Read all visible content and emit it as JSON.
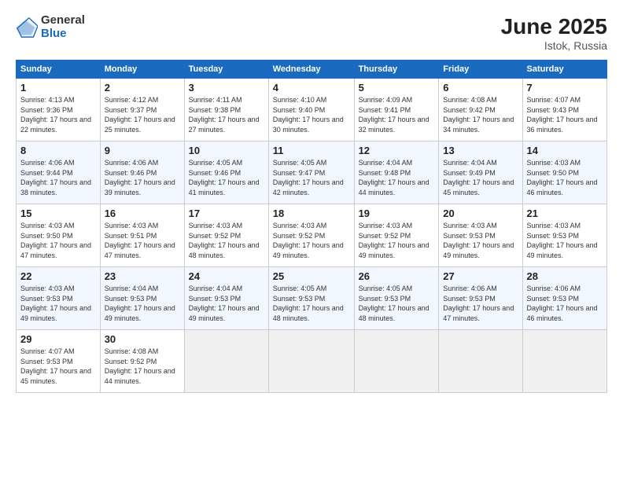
{
  "logo": {
    "general": "General",
    "blue": "Blue"
  },
  "title": "June 2025",
  "location": "Istok, Russia",
  "days_of_week": [
    "Sunday",
    "Monday",
    "Tuesday",
    "Wednesday",
    "Thursday",
    "Friday",
    "Saturday"
  ],
  "weeks": [
    [
      {
        "day": "1",
        "sunrise": "4:13 AM",
        "sunset": "9:36 PM",
        "daylight": "17 hours and 22 minutes."
      },
      {
        "day": "2",
        "sunrise": "4:12 AM",
        "sunset": "9:37 PM",
        "daylight": "17 hours and 25 minutes."
      },
      {
        "day": "3",
        "sunrise": "4:11 AM",
        "sunset": "9:38 PM",
        "daylight": "17 hours and 27 minutes."
      },
      {
        "day": "4",
        "sunrise": "4:10 AM",
        "sunset": "9:40 PM",
        "daylight": "17 hours and 30 minutes."
      },
      {
        "day": "5",
        "sunrise": "4:09 AM",
        "sunset": "9:41 PM",
        "daylight": "17 hours and 32 minutes."
      },
      {
        "day": "6",
        "sunrise": "4:08 AM",
        "sunset": "9:42 PM",
        "daylight": "17 hours and 34 minutes."
      },
      {
        "day": "7",
        "sunrise": "4:07 AM",
        "sunset": "9:43 PM",
        "daylight": "17 hours and 36 minutes."
      }
    ],
    [
      {
        "day": "8",
        "sunrise": "4:06 AM",
        "sunset": "9:44 PM",
        "daylight": "17 hours and 38 minutes."
      },
      {
        "day": "9",
        "sunrise": "4:06 AM",
        "sunset": "9:46 PM",
        "daylight": "17 hours and 39 minutes."
      },
      {
        "day": "10",
        "sunrise": "4:05 AM",
        "sunset": "9:46 PM",
        "daylight": "17 hours and 41 minutes."
      },
      {
        "day": "11",
        "sunrise": "4:05 AM",
        "sunset": "9:47 PM",
        "daylight": "17 hours and 42 minutes."
      },
      {
        "day": "12",
        "sunrise": "4:04 AM",
        "sunset": "9:48 PM",
        "daylight": "17 hours and 44 minutes."
      },
      {
        "day": "13",
        "sunrise": "4:04 AM",
        "sunset": "9:49 PM",
        "daylight": "17 hours and 45 minutes."
      },
      {
        "day": "14",
        "sunrise": "4:03 AM",
        "sunset": "9:50 PM",
        "daylight": "17 hours and 46 minutes."
      }
    ],
    [
      {
        "day": "15",
        "sunrise": "4:03 AM",
        "sunset": "9:50 PM",
        "daylight": "17 hours and 47 minutes."
      },
      {
        "day": "16",
        "sunrise": "4:03 AM",
        "sunset": "9:51 PM",
        "daylight": "17 hours and 47 minutes."
      },
      {
        "day": "17",
        "sunrise": "4:03 AM",
        "sunset": "9:52 PM",
        "daylight": "17 hours and 48 minutes."
      },
      {
        "day": "18",
        "sunrise": "4:03 AM",
        "sunset": "9:52 PM",
        "daylight": "17 hours and 49 minutes."
      },
      {
        "day": "19",
        "sunrise": "4:03 AM",
        "sunset": "9:52 PM",
        "daylight": "17 hours and 49 minutes."
      },
      {
        "day": "20",
        "sunrise": "4:03 AM",
        "sunset": "9:53 PM",
        "daylight": "17 hours and 49 minutes."
      },
      {
        "day": "21",
        "sunrise": "4:03 AM",
        "sunset": "9:53 PM",
        "daylight": "17 hours and 49 minutes."
      }
    ],
    [
      {
        "day": "22",
        "sunrise": "4:03 AM",
        "sunset": "9:53 PM",
        "daylight": "17 hours and 49 minutes."
      },
      {
        "day": "23",
        "sunrise": "4:04 AM",
        "sunset": "9:53 PM",
        "daylight": "17 hours and 49 minutes."
      },
      {
        "day": "24",
        "sunrise": "4:04 AM",
        "sunset": "9:53 PM",
        "daylight": "17 hours and 49 minutes."
      },
      {
        "day": "25",
        "sunrise": "4:05 AM",
        "sunset": "9:53 PM",
        "daylight": "17 hours and 48 minutes."
      },
      {
        "day": "26",
        "sunrise": "4:05 AM",
        "sunset": "9:53 PM",
        "daylight": "17 hours and 48 minutes."
      },
      {
        "day": "27",
        "sunrise": "4:06 AM",
        "sunset": "9:53 PM",
        "daylight": "17 hours and 47 minutes."
      },
      {
        "day": "28",
        "sunrise": "4:06 AM",
        "sunset": "9:53 PM",
        "daylight": "17 hours and 46 minutes."
      }
    ],
    [
      {
        "day": "29",
        "sunrise": "4:07 AM",
        "sunset": "9:53 PM",
        "daylight": "17 hours and 45 minutes."
      },
      {
        "day": "30",
        "sunrise": "4:08 AM",
        "sunset": "9:52 PM",
        "daylight": "17 hours and 44 minutes."
      },
      null,
      null,
      null,
      null,
      null
    ]
  ]
}
